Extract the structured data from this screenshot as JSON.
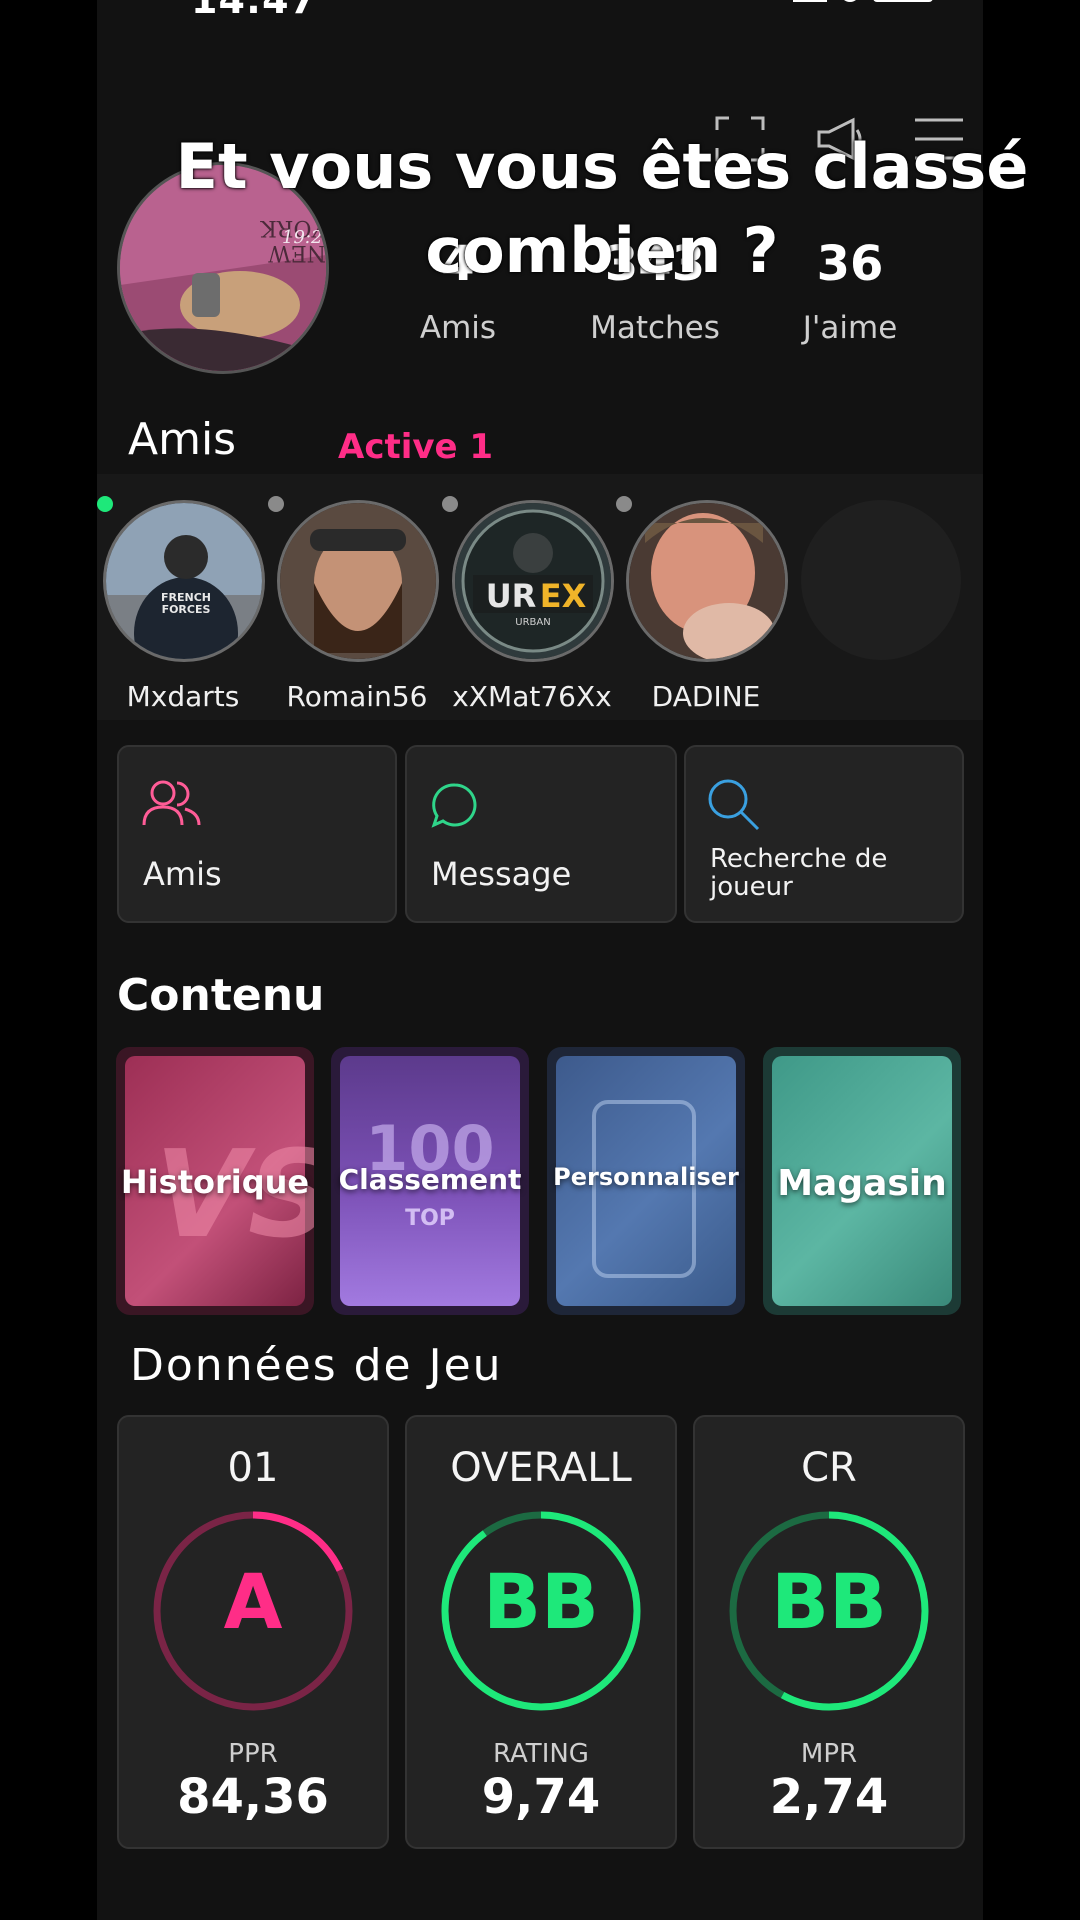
{
  "status_bar": {
    "time": "14:47"
  },
  "overlay_caption": {
    "line1": "Et vous vous êtes classé",
    "line2": "combien ?"
  },
  "profile": {
    "avatar_text": "NEW YORK",
    "avatar_time": "19:2",
    "stats": [
      {
        "value": "4",
        "label": "Amis"
      },
      {
        "value": "343",
        "label": "Matches"
      },
      {
        "value": "36",
        "label": "J'aime"
      }
    ]
  },
  "friends": {
    "title": "Amis",
    "active_label": "Active 1",
    "items": [
      {
        "name": "Mxdarts",
        "online": true
      },
      {
        "name": "Romain56",
        "online": false
      },
      {
        "name": "xXMat76Xx",
        "online": false
      },
      {
        "name": "DADINE",
        "online": false
      }
    ]
  },
  "actions": [
    {
      "label": "Amis",
      "icon": "friends-icon"
    },
    {
      "label": "Message",
      "icon": "chat-bubble-icon"
    },
    {
      "label": "Recherche de joueur",
      "icon": "search-icon"
    }
  ],
  "content": {
    "title": "Contenu",
    "cards": [
      {
        "label": "Historique",
        "badge": "VS"
      },
      {
        "label": "Classement",
        "badge": "100",
        "sub_badge": "TOP"
      },
      {
        "label": "Personnaliser"
      },
      {
        "label": "Magasin"
      }
    ]
  },
  "game_data": {
    "title": "Données de Jeu",
    "cards": [
      {
        "head": "01",
        "grade": "A",
        "stat_label": "PPR",
        "stat_value": "84,36",
        "color": "#ff2d87",
        "progress": 0.18
      },
      {
        "head": "OVERALL",
        "grade": "BB",
        "stat_label": "RATING",
        "stat_value": "9,74",
        "color": "#1ee87a",
        "progress": 0.9
      },
      {
        "head": "CR",
        "grade": "BB",
        "stat_label": "MPR",
        "stat_value": "2,74",
        "color": "#1ee87a",
        "progress": 0.58
      }
    ]
  },
  "colors": {
    "accent_pink": "#ff2d87",
    "accent_green": "#1ee87a",
    "background": "#121212"
  }
}
